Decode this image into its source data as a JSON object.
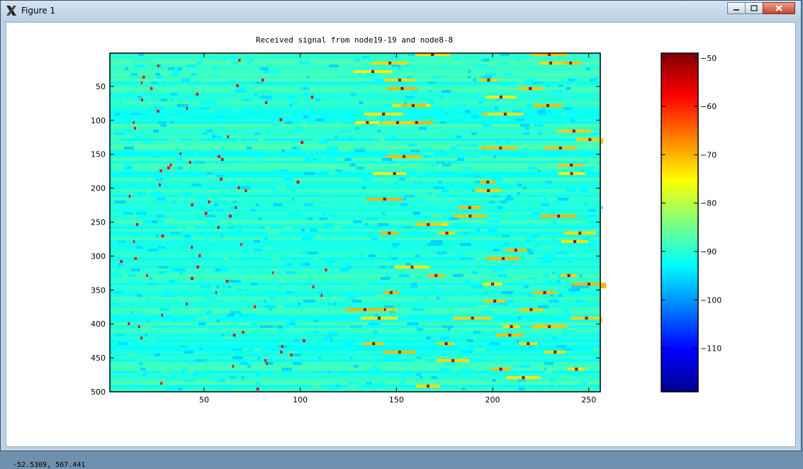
{
  "window": {
    "title": "Figure 1",
    "icon": "x-logo-icon"
  },
  "controls": {
    "minimize": "minimize-icon",
    "maximize": "maximize-icon",
    "close": "close-icon"
  },
  "status_text": "-52.5309,  567.441",
  "colors": {
    "titlebar": "#c8daec",
    "close": "#c4462b"
  },
  "chart_data": {
    "type": "heatmap",
    "title": "Received signal from node19-19 and node8-8",
    "x_ticks": [
      50,
      100,
      150,
      200,
      250
    ],
    "y_ticks": [
      50,
      100,
      150,
      200,
      250,
      300,
      350,
      400,
      450,
      500
    ],
    "xlim": [
      1,
      256
    ],
    "ylim": [
      1,
      500
    ],
    "colorbar": {
      "ticks": [
        -50,
        -60,
        -70,
        -80,
        -90,
        -100,
        -110
      ],
      "range": [
        -119,
        -49
      ],
      "colormap": "jet"
    },
    "background_level": -90,
    "description_of_values": "rows of noise near -90 with sweeping pulse peaks reaching about -50"
  }
}
